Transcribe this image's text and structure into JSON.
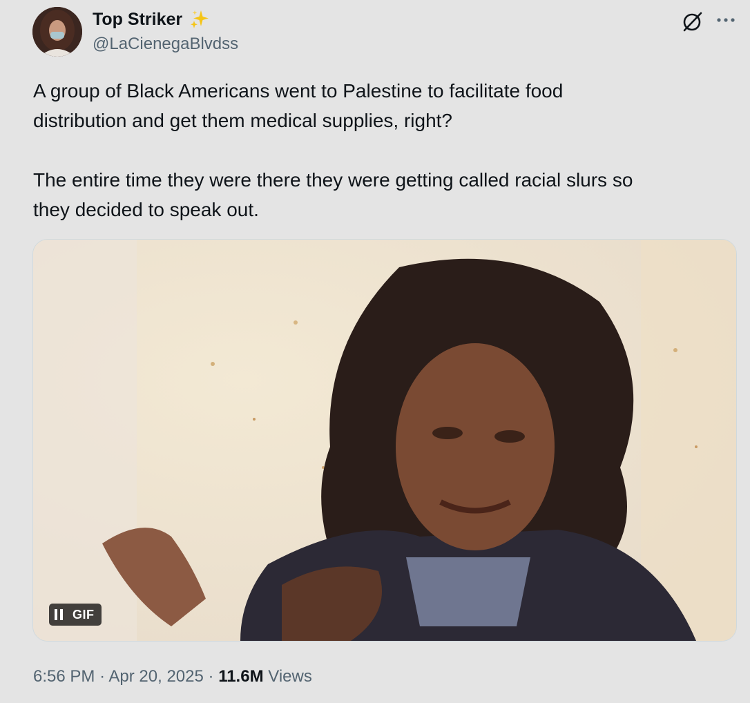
{
  "tweet": {
    "author": {
      "display_name": "Top Striker",
      "handle": "@LaCienegaBlvdss",
      "badge_icon": "sparkles-icon",
      "avatar_icon": "profile-avatar"
    },
    "actions": {
      "grok_icon": "grok-icon",
      "more_icon": "more-options-icon"
    },
    "text": {
      "paragraph_1": "A group of Black Americans went to Palestine to facilitate food distribution and get them medical supplies, right?",
      "paragraph_2": "The entire time they were there they were getting called racial slurs so they decided to speak out."
    },
    "media": {
      "badge_label": "GIF",
      "pause_icon": "pause-icon"
    },
    "meta": {
      "time": "6:56 PM",
      "date": "Apr 20, 2025",
      "separator": "·",
      "views_count": "11.6M",
      "views_label": "Views"
    }
  },
  "colors": {
    "background": "#e4e4e4",
    "text_primary": "#0f1419",
    "text_secondary": "#536471",
    "sparkle": "#f5c518"
  }
}
